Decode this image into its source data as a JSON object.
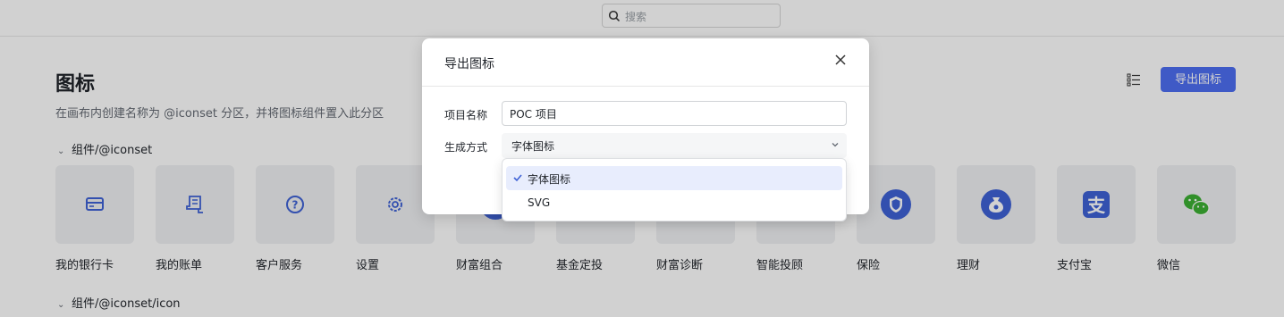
{
  "search": {
    "placeholder": "搜索"
  },
  "page": {
    "title": "图标",
    "description": "在画布内创建名称为 @iconset 分区，并将图标组件置入此分区",
    "export_button": "导出图标"
  },
  "groups": [
    {
      "label": "组件/@iconset"
    },
    {
      "label": "组件/@iconset/icon"
    }
  ],
  "icons": [
    {
      "label": "我的银行卡",
      "icon": "bank-card-icon"
    },
    {
      "label": "我的账单",
      "icon": "bill-icon"
    },
    {
      "label": "客户服务",
      "icon": "question-circle-icon"
    },
    {
      "label": "设置",
      "icon": "gear-icon"
    },
    {
      "label": "财富组合",
      "icon": "wealth-portfolio-icon"
    },
    {
      "label": "基金定投",
      "icon": "fund-investment-icon"
    },
    {
      "label": "财富诊断",
      "icon": "wealth-diagnosis-icon"
    },
    {
      "label": "智能投顾",
      "icon": "smart-advisor-icon"
    },
    {
      "label": "保险",
      "icon": "insurance-shield-icon"
    },
    {
      "label": "理财",
      "icon": "money-bag-icon"
    },
    {
      "label": "支付宝",
      "icon": "alipay-icon"
    },
    {
      "label": "微信",
      "icon": "wechat-icon"
    }
  ],
  "modal": {
    "title": "导出图标",
    "fields": {
      "project_name_label": "项目名称",
      "project_name_value": "POC 项目",
      "mode_label": "生成方式",
      "mode_value": "字体图标"
    },
    "options": [
      {
        "label": "字体图标",
        "selected": true
      },
      {
        "label": "SVG",
        "selected": false
      }
    ]
  },
  "colors": {
    "accent": "#4e6ef2",
    "icon_blue": "#3f62d6",
    "wechat_green": "#3cb034"
  }
}
